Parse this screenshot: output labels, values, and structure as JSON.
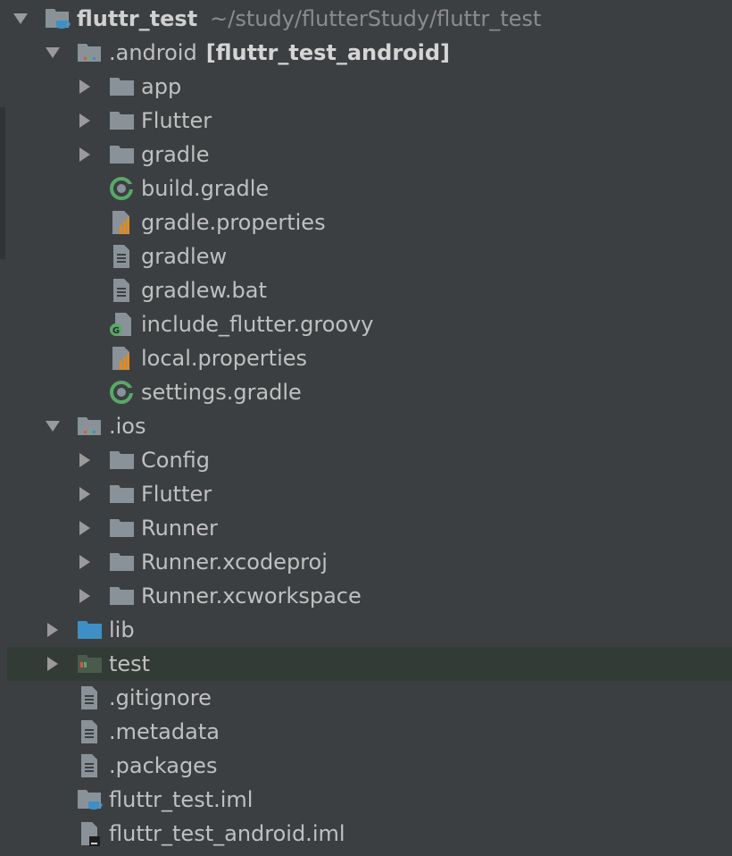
{
  "project": {
    "name": "fluttr_test",
    "path": "~/study/flutterStudy/fluttr_test"
  },
  "android": {
    "name": ".android",
    "module": "[fluttr_test_android]",
    "children": [
      "app",
      "Flutter",
      "gradle",
      "build.gradle",
      "gradle.properties",
      "gradlew",
      "gradlew.bat",
      "include_flutter.groovy",
      "local.properties",
      "settings.gradle"
    ]
  },
  "ios": {
    "name": ".ios",
    "children": [
      "Config",
      "Flutter",
      "Runner",
      "Runner.xcodeproj",
      "Runner.xcworkspace"
    ]
  },
  "root_items": [
    ".gitignore",
    ".metadata",
    ".packages",
    "fluttr_test.iml",
    "fluttr_test_android.iml"
  ],
  "lib_label": "lib",
  "test_label": "test",
  "colors": {
    "background": "#3c3f41",
    "selected_row": "#323b35",
    "folder": "#8a9299",
    "source_folder": "#3d8fc6",
    "gradle_green": "#59a869",
    "properties_orange": "#e08a1f"
  },
  "icons": {
    "expanded": "triangle-down-icon",
    "collapsed": "triangle-right-icon",
    "folder": "folder-icon",
    "module_folder": "module-folder-icon",
    "gradle": "gradle-icon",
    "properties": "properties-file-icon",
    "text_file": "text-file-icon",
    "groovy": "groovy-file-icon",
    "iml": "iml-file-icon"
  }
}
